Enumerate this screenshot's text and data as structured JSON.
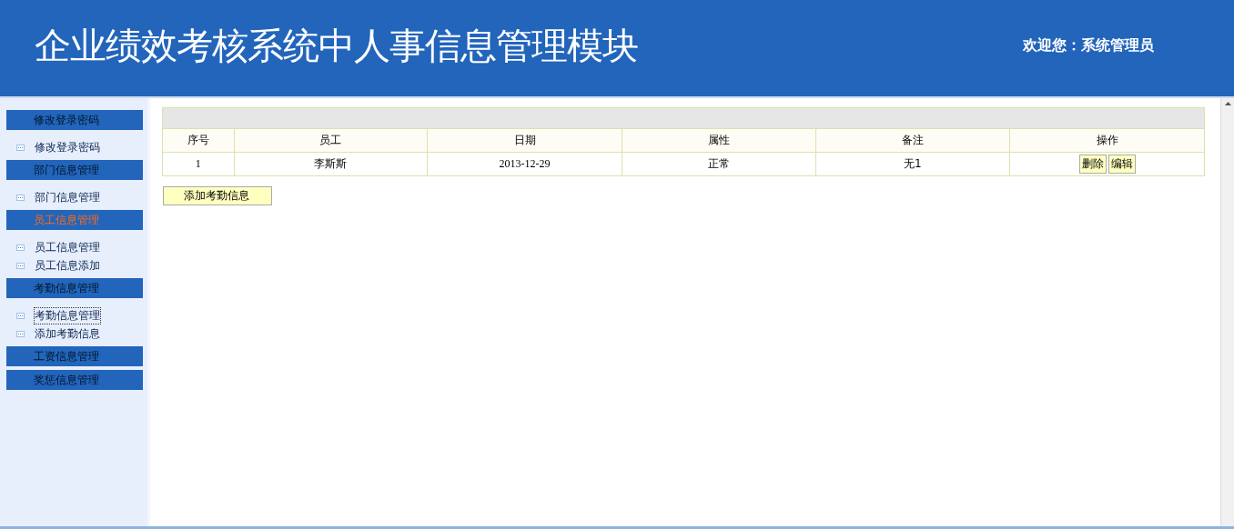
{
  "header": {
    "title": "企业绩效考核系统中人事信息管理模块",
    "welcome": "欢迎您：系统管理员"
  },
  "sidebar": {
    "groups": [
      {
        "label": "修改登录密码",
        "selected": false,
        "items": [
          {
            "label": "修改登录密码",
            "selected": false
          }
        ]
      },
      {
        "label": "部门信息管理",
        "selected": false,
        "items": [
          {
            "label": "部门信息管理",
            "selected": false
          }
        ]
      },
      {
        "label": "员工信息管理",
        "selected": true,
        "items": [
          {
            "label": "员工信息管理",
            "selected": false
          },
          {
            "label": "员工信息添加",
            "selected": false
          }
        ]
      },
      {
        "label": "考勤信息管理",
        "selected": false,
        "items": [
          {
            "label": "考勤信息管理",
            "selected": true
          },
          {
            "label": "添加考勤信息",
            "selected": false
          }
        ]
      },
      {
        "label": "工资信息管理",
        "selected": false
      },
      {
        "label": "奖惩信息管理",
        "selected": false
      }
    ]
  },
  "table": {
    "columns": [
      "序号",
      "员工",
      "日期",
      "属性",
      "备注",
      "操作"
    ],
    "rows": [
      {
        "cells": [
          "1",
          "李斯斯",
          "2013-12-29",
          "正常",
          "无1"
        ],
        "actions": [
          "删除",
          "编辑"
        ]
      }
    ]
  },
  "add_button": "添加考勤信息"
}
